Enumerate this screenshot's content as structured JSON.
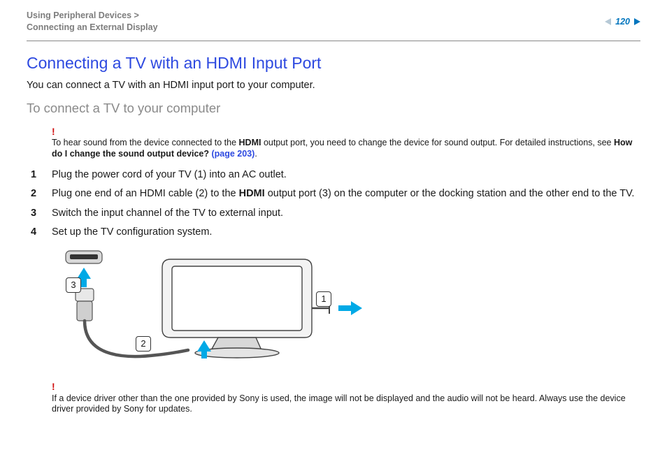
{
  "header": {
    "breadcrumb_line1": "Using Peripheral Devices >",
    "breadcrumb_line2": "Connecting an External Display",
    "page_number": "120"
  },
  "content": {
    "title": "Connecting a TV with an HDMI Input Port",
    "intro": "You can connect a TV with an HDMI input port to your computer.",
    "subtitle": "To connect a TV to your computer",
    "note_top": {
      "bang": "!",
      "pre": "To hear sound from the device connected to the ",
      "b1": "HDMI",
      "mid": " output port, you need to change the device for sound output. For detailed instructions, see ",
      "b2": "How do I change the sound output device? ",
      "link": "(page 203)",
      "post": "."
    },
    "steps": {
      "s1": "Plug the power cord of your TV (1) into an AC outlet.",
      "s2_pre": "Plug one end of an HDMI cable (2) to the ",
      "s2_b": "HDMI",
      "s2_post": " output port (3) on the computer or the docking station and the other end to the TV.",
      "s3": "Switch the input channel of the TV to external input.",
      "s4": "Set up the TV configuration system."
    },
    "callouts": {
      "c1": "1",
      "c2": "2",
      "c3": "3"
    },
    "note_bottom": {
      "bang": "!",
      "text": "If a device driver other than the one provided by Sony is used, the image will not be displayed and the audio will not be heard. Always use the device driver provided by Sony for updates."
    }
  }
}
